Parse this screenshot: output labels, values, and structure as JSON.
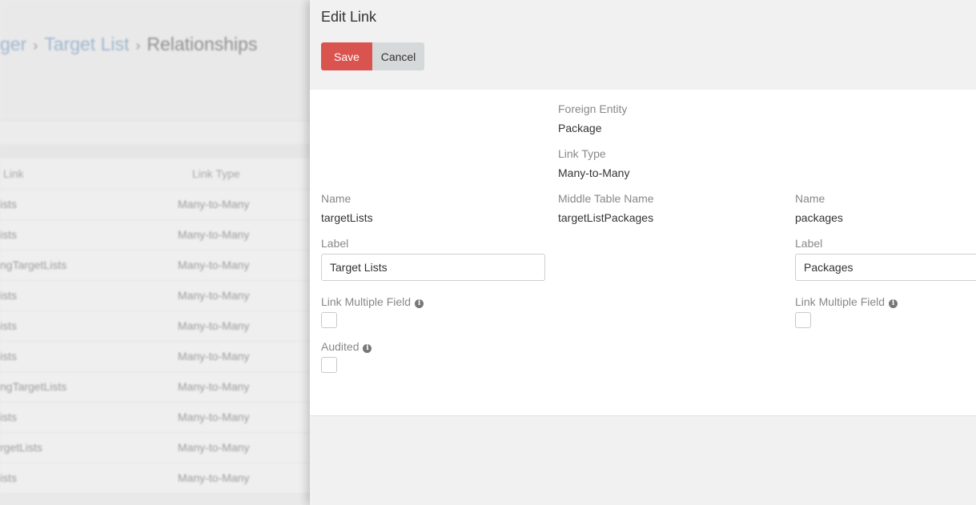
{
  "background": {
    "breadcrumbs": [
      {
        "label": "ger"
      },
      {
        "label": "Target List"
      },
      {
        "label": "Relationships"
      }
    ],
    "breadcrumb_separator": "›",
    "table": {
      "columns": [
        "Link",
        "Link Type"
      ],
      "rows": [
        {
          "link": "ists",
          "type": "Many-to-Many"
        },
        {
          "link": "ists",
          "type": "Many-to-Many"
        },
        {
          "link": "ngTargetLists",
          "type": "Many-to-Many"
        },
        {
          "link": "ists",
          "type": "Many-to-Many"
        },
        {
          "link": "ists",
          "type": "Many-to-Many"
        },
        {
          "link": "ists",
          "type": "Many-to-Many"
        },
        {
          "link": "ngTargetLists",
          "type": "Many-to-Many"
        },
        {
          "link": "ists",
          "type": "Many-to-Many"
        },
        {
          "link": "rgetLists",
          "type": "Many-to-Many"
        },
        {
          "link": "ists",
          "type": "Many-to-Many"
        }
      ]
    }
  },
  "modal": {
    "title": "Edit Link",
    "save_label": "Save",
    "cancel_label": "Cancel",
    "foreign_entity": {
      "label": "Foreign Entity",
      "value": "Package"
    },
    "link_type": {
      "label": "Link Type",
      "value": "Many-to-Many"
    },
    "middle_table": {
      "label": "Middle Table Name",
      "value": "targetListPackages"
    },
    "left": {
      "name_label": "Name",
      "name_value": "targetLists",
      "label_label": "Label",
      "label_value": "Target Lists",
      "link_multiple_label": "Link Multiple Field",
      "audited_label": "Audited"
    },
    "right": {
      "name_label": "Name",
      "name_value": "packages",
      "label_label": "Label",
      "label_value": "Packages",
      "link_multiple_label": "Link Multiple Field"
    },
    "info_glyph": "i"
  },
  "colors": {
    "save_button": "#d9534f",
    "cancel_button": "#d6d9da",
    "breadcrumb_link": "#9fb6cf"
  }
}
